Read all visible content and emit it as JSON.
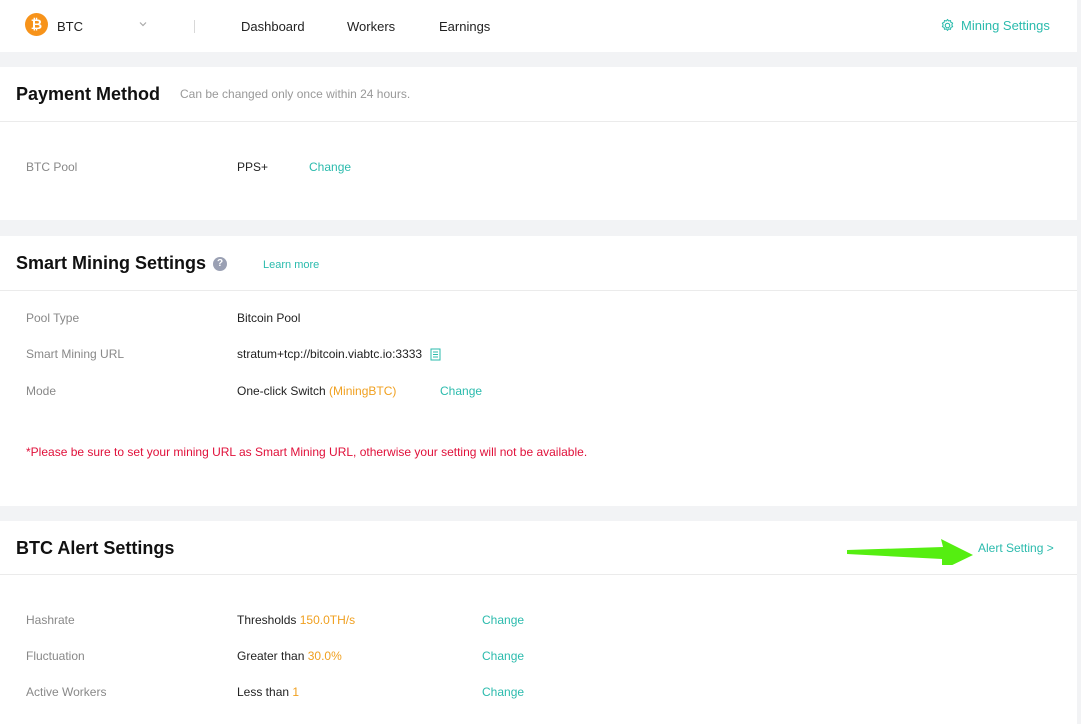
{
  "header": {
    "coin_symbol": "₿",
    "coin": "BTC",
    "nav": [
      "Dashboard",
      "Workers",
      "Earnings"
    ],
    "mining_settings": "Mining Settings"
  },
  "payment": {
    "title": "Payment Method",
    "subtitle": "Can be changed only once within 24 hours.",
    "label": "BTC Pool",
    "value": "PPS+",
    "action": "Change"
  },
  "smart": {
    "title": "Smart Mining Settings",
    "help": "?",
    "learn_more": "Learn more",
    "pool_type_label": "Pool Type",
    "pool_type_value": "Bitcoin Pool",
    "url_label": "Smart Mining URL",
    "url_value": "stratum+tcp://bitcoin.viabtc.io:3333",
    "mode_label": "Mode",
    "mode_value": "One-click Switch",
    "mode_detail": "(MiningBTC)",
    "mode_action": "Change",
    "warning": "*Please be sure to set your mining URL as Smart Mining URL, otherwise your setting will not be available."
  },
  "alerts": {
    "title": "BTC Alert Settings",
    "link": "Alert Setting >",
    "rows": [
      {
        "label": "Hashrate",
        "prefix": "Thresholds",
        "value": "150.0TH/s",
        "action": "Change"
      },
      {
        "label": "Fluctuation",
        "prefix": "Greater than",
        "value": "30.0%",
        "action": "Change"
      },
      {
        "label": "Active Workers",
        "prefix": "Less than",
        "value": "1",
        "action": "Change"
      }
    ]
  },
  "colors": {
    "accent": "#2bbbad",
    "highlight": "#f0a020",
    "warning": "#e0103a",
    "arrow": "#55ee11"
  }
}
